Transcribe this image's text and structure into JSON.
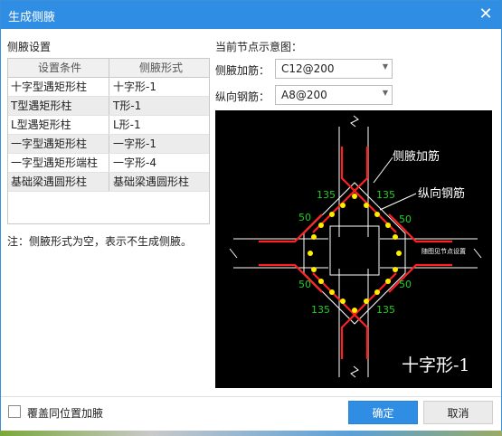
{
  "window": {
    "title": "生成侧腋",
    "close_glyph": "✕"
  },
  "left": {
    "section_title": "侧腋设置",
    "columns": [
      "设置条件",
      "侧腋形式"
    ],
    "rows": [
      [
        "十字型遇矩形柱",
        "十字形-1"
      ],
      [
        "T型遇矩形柱",
        "T形-1"
      ],
      [
        "L型遇矩形柱",
        "L形-1"
      ],
      [
        "一字型遇矩形柱",
        "一字形-1"
      ],
      [
        "一字型遇矩形端柱",
        "一字形-4"
      ],
      [
        "基础梁遇圆形柱",
        "基础梁遇圆形柱"
      ]
    ],
    "note": "注：侧腋形式为空，表示不生成侧腋。"
  },
  "right": {
    "section_title": "当前节点示意图：",
    "side_rebar_label": "侧腋加筋：",
    "side_rebar_value": "C12@200",
    "long_rebar_label": "纵向钢筋：",
    "long_rebar_value": "A8@200"
  },
  "diagram": {
    "label_side": "侧腋加筋",
    "label_long": "纵向钢筋",
    "label_hook_tl": "135",
    "label_hook_tr": "135",
    "label_hook_bl": "135",
    "label_hook_br": "135",
    "label_50_tl": "50",
    "label_50_tr": "50",
    "label_50_bl": "50",
    "label_50_br": "50",
    "label_node": "随图见节点设置",
    "title": "十字形-1",
    "colors": {
      "beam": "#ffffff",
      "rebar": "#ff2020",
      "bar_dot": "#ffee00",
      "dim_text": "#22cc22"
    }
  },
  "footer": {
    "checkbox_label": "覆盖同位置加腋",
    "ok_label": "确定",
    "cancel_label": "取消"
  }
}
